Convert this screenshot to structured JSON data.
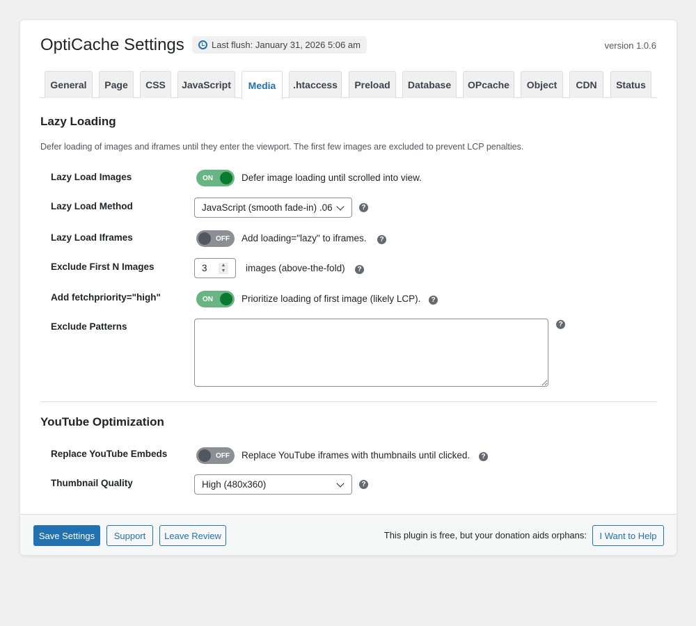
{
  "header": {
    "title": "OptiCache Settings",
    "last_flush": "Last flush: January 31, 2026 5:06 am",
    "version": "version 1.0.6"
  },
  "tabs": [
    "General",
    "Page",
    "CSS",
    "JavaScript",
    "Media",
    ".htaccess",
    "Preload",
    "Database",
    "OPcache",
    "Object",
    "CDN",
    "Status"
  ],
  "active_tab": "Media",
  "lazy": {
    "heading": "Lazy Loading",
    "description": "Defer loading of images and iframes until they enter the viewport. The first few images are excluded to prevent LCP penalties.",
    "images": {
      "label": "Lazy Load Images",
      "state": "ON",
      "text": "Defer image loading until scrolled into view."
    },
    "method": {
      "label": "Lazy Load Method",
      "value": "JavaScript (smooth fade-in) .06"
    },
    "iframes": {
      "label": "Lazy Load Iframes",
      "state": "OFF",
      "text": "Add loading=\"lazy\" to iframes."
    },
    "exclude_n": {
      "label": "Exclude First N Images",
      "value": "3",
      "text": "images (above-the-fold)"
    },
    "fetch": {
      "label": "Add fetchpriority=\"high\"",
      "state": "ON",
      "text": "Prioritize loading of first image (likely LCP)."
    },
    "patterns": {
      "label": "Exclude Patterns",
      "value": ""
    }
  },
  "youtube": {
    "heading": "YouTube Optimization",
    "replace": {
      "label": "Replace YouTube Embeds",
      "state": "OFF",
      "text": "Replace YouTube iframes with thumbnails until clicked."
    },
    "quality": {
      "label": "Thumbnail Quality",
      "value": "High (480x360)"
    }
  },
  "help_glyph": "?",
  "footer": {
    "save": "Save Settings",
    "support": "Support",
    "review": "Leave Review",
    "donation_text": "This plugin is free, but your donation aids orphans:",
    "help": "I Want to Help"
  }
}
